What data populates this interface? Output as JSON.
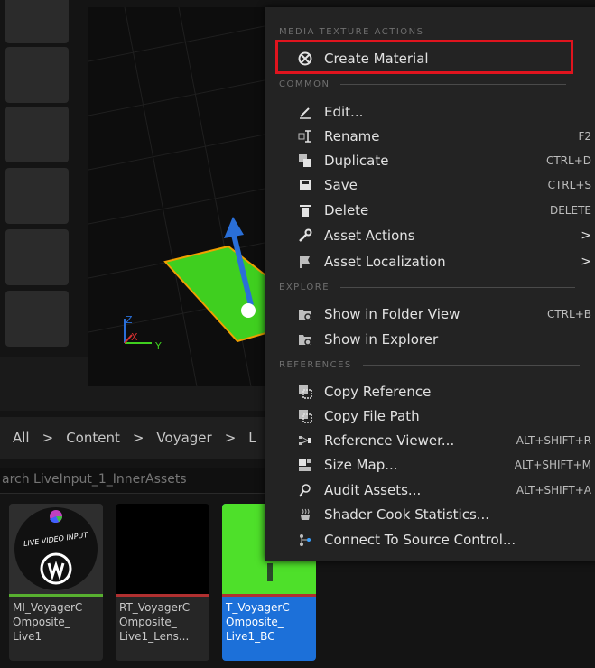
{
  "breadcrumb": {
    "items": [
      "All",
      "Content",
      "Voyager",
      "L"
    ],
    "separator": ">"
  },
  "search": {
    "placeholder": "arch LiveInput_1_InnerAssets"
  },
  "tiles": [
    {
      "name": "MI_VoyagerC\nOmposite_\nLive1",
      "thumb_text": "LIVE VIDEO INPUT",
      "bar_color": "#58b030"
    },
    {
      "name": "RT_VoyagerC\nOmposite_\nLive1_Lens...",
      "bar_color": "#b03030"
    },
    {
      "name": "T_VoyagerC\nOmposite_\nLive1_BC",
      "bar_color": "#b03030",
      "selected": true
    }
  ],
  "viewport": {
    "axis_x": "X",
    "axis_y": "Y",
    "axis_z": "Z"
  },
  "menu": {
    "sections": {
      "media": "MEDIA TEXTURE ACTIONS",
      "common": "COMMON",
      "explore": "EXPLORE",
      "references": "REFERENCES"
    },
    "media_items": [
      {
        "label": "Create Material",
        "icon": "material-icon"
      }
    ],
    "common_items": [
      {
        "label": "Edit...",
        "icon": "edit-icon",
        "shortcut": ""
      },
      {
        "label": "Rename",
        "icon": "rename-icon",
        "shortcut": "F2"
      },
      {
        "label": "Duplicate",
        "icon": "duplicate-icon",
        "shortcut": "CTRL+D"
      },
      {
        "label": "Save",
        "icon": "save-icon",
        "shortcut": "CTRL+S"
      },
      {
        "label": "Delete",
        "icon": "delete-icon",
        "shortcut": "DELETE"
      },
      {
        "label": "Asset Actions",
        "icon": "wrench-icon",
        "submenu": ">"
      },
      {
        "label": "Asset Localization",
        "icon": "flag-icon",
        "submenu": ">"
      }
    ],
    "explore_items": [
      {
        "label": "Show in Folder View",
        "icon": "folder-icon",
        "shortcut": "CTRL+B"
      },
      {
        "label": "Show in Explorer",
        "icon": "explorer-icon",
        "shortcut": ""
      }
    ],
    "references_items": [
      {
        "label": "Copy Reference",
        "icon": "copy-reference-icon",
        "shortcut": ""
      },
      {
        "label": "Copy File Path",
        "icon": "copy-path-icon",
        "shortcut": ""
      },
      {
        "label": "Reference Viewer...",
        "icon": "reference-viewer-icon",
        "shortcut": "ALT+SHIFT+R"
      },
      {
        "label": "Size Map...",
        "icon": "size-map-icon",
        "shortcut": "ALT+SHIFT+M"
      },
      {
        "label": "Audit Assets...",
        "icon": "audit-icon",
        "shortcut": "ALT+SHIFT+A"
      },
      {
        "label": "Shader Cook Statistics...",
        "icon": "shader-icon",
        "shortcut": ""
      },
      {
        "label": "Connect To Source Control...",
        "icon": "source-control-icon",
        "shortcut": ""
      }
    ]
  },
  "colors": {
    "highlight_border": "#e0141e",
    "selection": "#1c70d9",
    "menu_bg": "#232323"
  }
}
